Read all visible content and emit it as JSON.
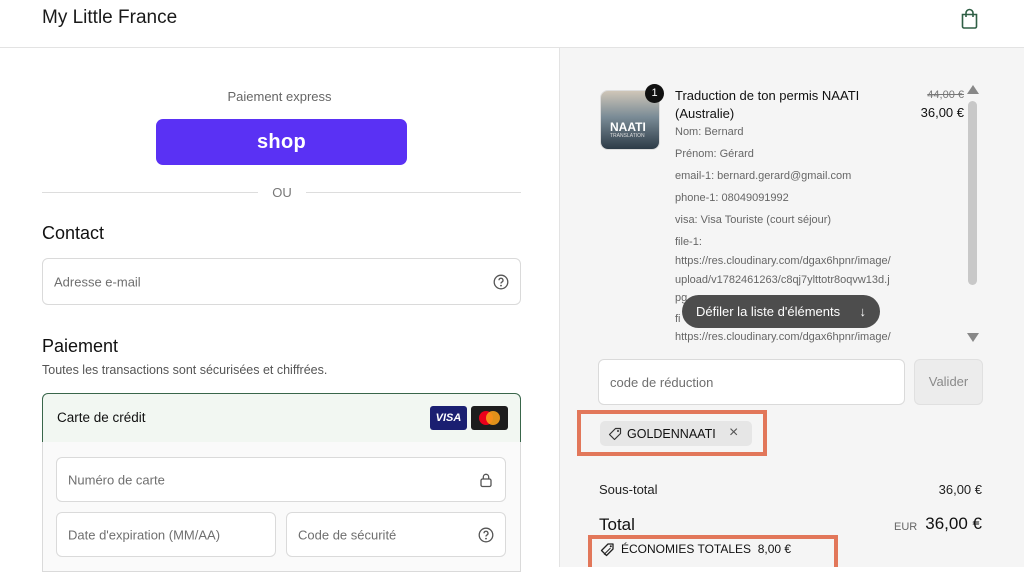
{
  "header": {
    "brand": "My Little France",
    "cart_icon": "shopping-bag-icon"
  },
  "express": {
    "label": "Paiement express",
    "shop_button": "shop",
    "separator": "OU"
  },
  "contact": {
    "title": "Contact",
    "email_placeholder": "Adresse e-mail",
    "help_icon": "question-circle-icon"
  },
  "payment": {
    "title": "Paiement",
    "subtitle": "Toutes les transactions sont sécurisées et chiffrées.",
    "method": "Carte de crédit",
    "card_brands": [
      "VISA",
      "Mastercard"
    ],
    "card_number_placeholder": "Numéro de carte",
    "expiry_placeholder": "Date d'expiration (MM/AA)",
    "security_placeholder": "Code de sécurité"
  },
  "order": {
    "product": {
      "quantity": "1",
      "thumbnail_title": "NAATI",
      "thumbnail_sub": "TRANSLATION",
      "title": "Traduction de ton permis NAATI (Australie)",
      "price_old": "44,00 €",
      "price_new": "36,00 €",
      "meta": [
        "Nom: Bernard",
        "Prénom: Gérard",
        "email-1: bernard.gerard@gmail.com",
        "phone-1: 08049091992",
        "visa: Visa Touriste (court séjour)",
        "file-1:",
        "https://res.cloudinary.com/dgax6hpnr/image/",
        "upload/v1782461263/c8qj7ylttotr8oqvw13d.j",
        "pg",
        "fi",
        "https://res.cloudinary.com/dgax6hpnr/image/"
      ]
    },
    "scroll_tooltip": "Défiler la liste d'éléments",
    "discount_placeholder": "code de réduction",
    "apply_button": "Valider",
    "applied_code": "GOLDENNAATI",
    "subtotal_label": "Sous-total",
    "subtotal_value": "36,00 €",
    "total_label": "Total",
    "currency": "EUR",
    "total_value": "36,00 €",
    "savings_label": "ÉCONOMIES TOTALES",
    "savings_value": "8,00 €",
    "highlight_color": "#e2775a",
    "shop_color": "#5a31f4"
  }
}
